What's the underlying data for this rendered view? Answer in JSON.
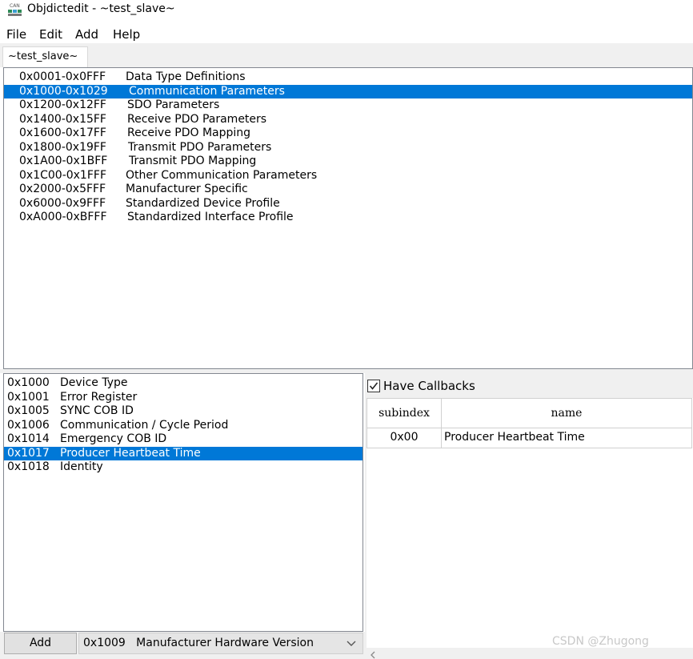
{
  "window": {
    "title": "Objdictedit - ~test_slave~",
    "icon": "can-app-icon"
  },
  "menu": {
    "file": "File",
    "edit": "Edit",
    "add": "Add",
    "help": "Help"
  },
  "tabs": [
    {
      "label": "~test_slave~"
    }
  ],
  "ranges": [
    {
      "id": "0x0001-0x0FFF",
      "name": "Data Type Definitions"
    },
    {
      "id": "0x1000-0x1029",
      "name": "Communication Parameters",
      "selected": true
    },
    {
      "id": "0x1200-0x12FF",
      "name": "SDO Parameters"
    },
    {
      "id": "0x1400-0x15FF",
      "name": "Receive PDO Parameters"
    },
    {
      "id": "0x1600-0x17FF",
      "name": "Receive PDO Mapping"
    },
    {
      "id": "0x1800-0x19FF",
      "name": "Transmit PDO Parameters"
    },
    {
      "id": "0x1A00-0x1BFF",
      "name": "Transmit PDO Mapping"
    },
    {
      "id": "0x1C00-0x1FFF",
      "name": "Other Communication Parameters"
    },
    {
      "id": "0x2000-0x5FFF",
      "name": "Manufacturer Specific"
    },
    {
      "id": "0x6000-0x9FFF",
      "name": "Standardized Device Profile"
    },
    {
      "id": "0xA000-0xBFFF",
      "name": "Standardized Interface Profile"
    }
  ],
  "indexes": [
    {
      "id": "0x1000",
      "name": "Device Type"
    },
    {
      "id": "0x1001",
      "name": "Error Register"
    },
    {
      "id": "0x1005",
      "name": "SYNC COB ID"
    },
    {
      "id": "0x1006",
      "name": "Communication / Cycle Period"
    },
    {
      "id": "0x1014",
      "name": "Emergency COB ID"
    },
    {
      "id": "0x1017",
      "name": "Producer Heartbeat Time",
      "selected": true
    },
    {
      "id": "0x1018",
      "name": "Identity"
    }
  ],
  "add_bar": {
    "add_label": "Add",
    "combo_value": "0x1009   Manufacturer Hardware Version"
  },
  "callbacks": {
    "label": "Have Callbacks",
    "checked": true
  },
  "grid": {
    "headers": [
      "subindex",
      "name"
    ],
    "rows": [
      {
        "subindex": "0x00",
        "name": "Producer Heartbeat Time"
      }
    ]
  },
  "watermark": "CSDN @Zhugong",
  "colors": {
    "selection": "#0078d7",
    "panel_bg": "#f0f0f0"
  }
}
